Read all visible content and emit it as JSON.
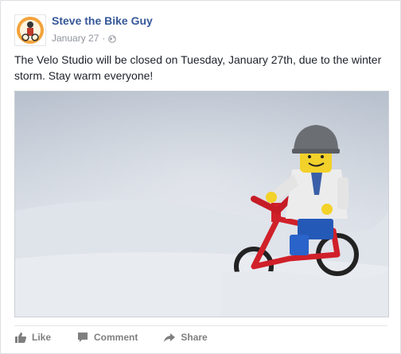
{
  "post": {
    "author": "Steve the Bike Guy",
    "date": "January 27",
    "separator": "·",
    "privacy_icon": "globe-icon",
    "body": "The Velo Studio will be closed on Tuesday, January 27th, due to the winter storm. Stay warm everyone!"
  },
  "actions": {
    "like": "Like",
    "comment": "Comment",
    "share": "Share"
  },
  "colors": {
    "author_link": "#365899",
    "meta": "#90949c",
    "action": "#7f7f7f"
  }
}
